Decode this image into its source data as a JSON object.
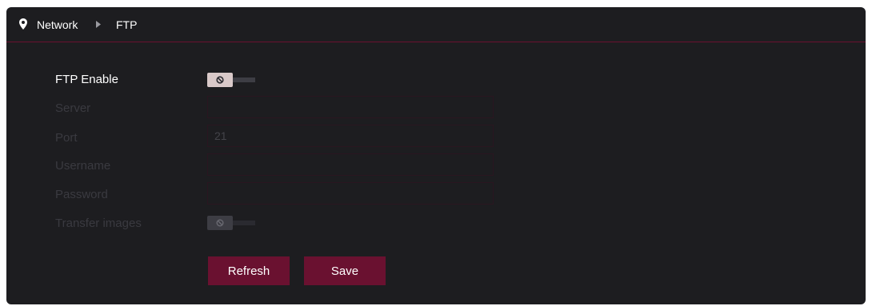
{
  "breadcrumb": {
    "items": [
      "Network",
      "FTP"
    ]
  },
  "form": {
    "ftp_enable_label": "FTP Enable",
    "server_label": "Server",
    "server_value": "",
    "port_label": "Port",
    "port_value": "21",
    "username_label": "Username",
    "username_value": "",
    "password_label": "Password",
    "password_value": "",
    "transfer_images_label": "Transfer images",
    "ftp_enabled": false,
    "transfer_images_enabled": false
  },
  "buttons": {
    "refresh": "Refresh",
    "save": "Save"
  },
  "colors": {
    "accent": "#6a1130",
    "background": "#1d1d20"
  },
  "icons": {
    "location": "map-pin-icon",
    "separator": "caret-right-icon",
    "toggle_off": "ban-icon"
  }
}
